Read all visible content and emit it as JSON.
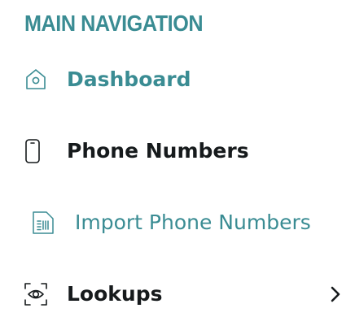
{
  "nav": {
    "section_title": "MAIN NAVIGATION",
    "items": [
      {
        "label": "Dashboard",
        "icon": "home-icon",
        "state": "active"
      },
      {
        "label": "Phone Numbers",
        "icon": "phone-icon",
        "state": "default"
      },
      {
        "label": "Import Phone Numbers",
        "icon": "sim-card-icon",
        "state": "active-sub"
      },
      {
        "label": "Lookups",
        "icon": "eye-scan-icon",
        "state": "default",
        "expand_icon": "chevron-right-icon"
      }
    ]
  },
  "colors": {
    "accent": "#3a8c93",
    "text": "#161a1c",
    "background": "#ffffff"
  }
}
